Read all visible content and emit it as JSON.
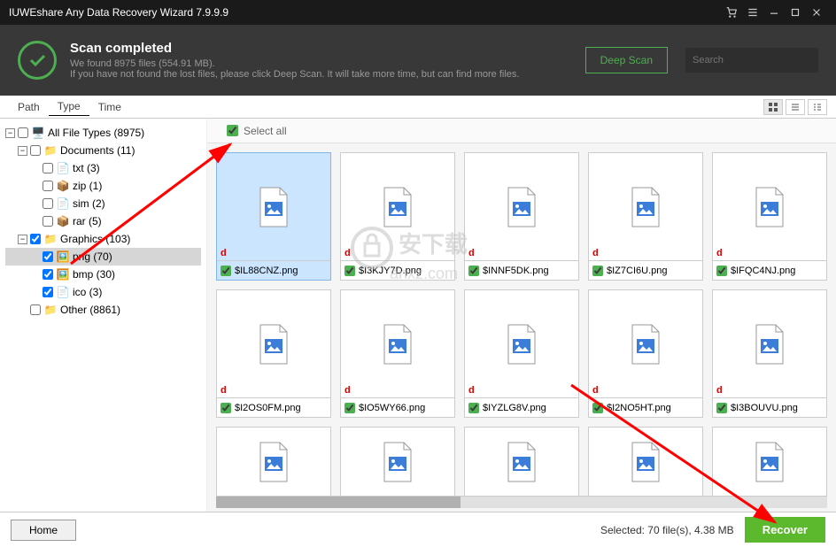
{
  "title": "IUWEshare Any Data Recovery Wizard 7.9.9.9",
  "header": {
    "heading": "Scan completed",
    "line1": "We found 8975 files (554.91 MB).",
    "line2": "If you have not found the lost files, please click Deep Scan. It will take more time, but can find more files.",
    "deep_scan": "Deep Scan",
    "search_placeholder": "Search"
  },
  "tabs": {
    "path": "Path",
    "type": "Type",
    "time": "Time"
  },
  "tree": {
    "all": "All File Types (8975)",
    "documents": "Documents (11)",
    "txt": "txt (3)",
    "zip": "zip (1)",
    "sim": "sim (2)",
    "rar": "rar (5)",
    "graphics": "Graphics (103)",
    "png": "png (70)",
    "bmp": "bmp (30)",
    "ico": "ico (3)",
    "other": "Other  (8861)"
  },
  "select_all": "Select all",
  "files": [
    {
      "name": "$IL88CNZ.png"
    },
    {
      "name": "$I3KJY7D.png"
    },
    {
      "name": "$INNF5DK.png"
    },
    {
      "name": "$IZ7CI6U.png"
    },
    {
      "name": "$IFQC4NJ.png"
    },
    {
      "name": "$I2OS0FM.png"
    },
    {
      "name": "$IO5WY66.png"
    },
    {
      "name": "$IYZLG8V.png"
    },
    {
      "name": "$I2NO5HT.png"
    },
    {
      "name": "$I3BOUVU.png"
    }
  ],
  "footer": {
    "home": "Home",
    "status": "Selected: 70 file(s), 4.38 MB",
    "recover": "Recover"
  },
  "watermark": {
    "l1": "安下载",
    "l2": "anxz.com"
  }
}
